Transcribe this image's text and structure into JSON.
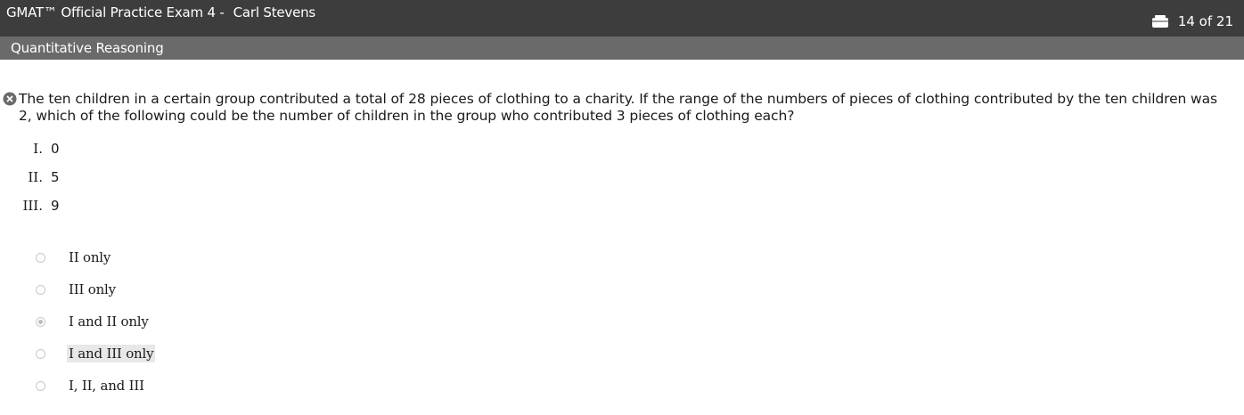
{
  "header": {
    "exam_title": "GMAT™ Official Practice Exam 4 -",
    "candidate_name": "Carl Stevens",
    "progress_icon": "calculator-icon",
    "progress_text": "14 of 21"
  },
  "section": {
    "name": "Quantitative Reasoning"
  },
  "question": {
    "flag_icon": "x-circle-icon",
    "text": "The ten children in a certain group contributed a total of 28 pieces of clothing to a charity. If the range of the numbers of pieces of clothing contributed by the ten children was 2, which of the following could be the number of children in the group who contributed 3 pieces of clothing each?",
    "statements": [
      {
        "numeral": "I.",
        "value": "0"
      },
      {
        "numeral": "II.",
        "value": "5"
      },
      {
        "numeral": "III.",
        "value": "9"
      }
    ]
  },
  "answers": {
    "options": [
      {
        "label": "II only",
        "selected": false
      },
      {
        "label": "III only",
        "selected": false
      },
      {
        "label": "I and II only",
        "selected": true
      },
      {
        "label": "I and III only",
        "selected": false,
        "highlighted": true
      },
      {
        "label": "I, II, and III",
        "selected": false
      }
    ]
  }
}
